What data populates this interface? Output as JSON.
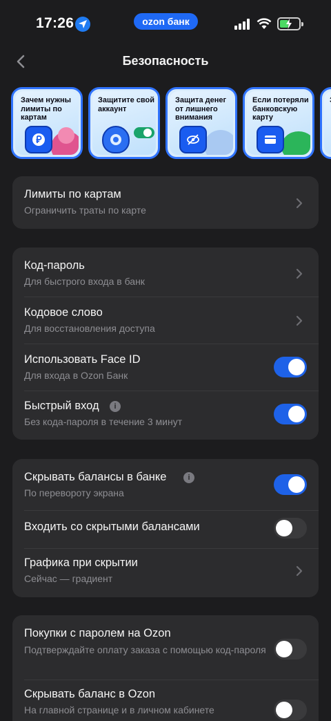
{
  "status_bar": {
    "time": "17:26",
    "brand": "ozon банк",
    "icons": [
      "location-arrow-icon",
      "signal-icon",
      "wifi-icon",
      "battery-charging-icon"
    ]
  },
  "header": {
    "title": "Безопасность",
    "back_icon": "chevron-left-icon"
  },
  "stories": [
    {
      "text": "Зачем нужны лимиты по картам",
      "icon": "ruble-icon"
    },
    {
      "text": "Защитите свой аккаунт",
      "icon": "shield-icon"
    },
    {
      "text": "Защита денег от лишнего внимания",
      "icon": "eye-off-icon"
    },
    {
      "text": "Если потеряли банковскую карту",
      "icon": "card-icon"
    },
    {
      "text": "З о",
      "icon": ""
    }
  ],
  "sections": {
    "limits": {
      "title": "Лимиты по картам",
      "subtitle": "Ограничить траты по карте"
    },
    "auth": {
      "passcode_title": "Код-пароль",
      "passcode_subtitle": "Для быстрого входа в банк",
      "codeword_title": "Кодовое слово",
      "codeword_subtitle": "Для восстановления доступа",
      "faceid_title": "Использовать Face ID",
      "faceid_subtitle": "Для входа в Ozon Банк",
      "faceid_on": true,
      "quick_title": "Быстрый вход",
      "quick_subtitle": "Без кода-пароля в течение 3 минут",
      "quick_on": true
    },
    "balances": {
      "hide_title": "Скрывать балансы в банке",
      "hide_subtitle": "По перевороту экрана",
      "hide_on": true,
      "enter_hidden_title": "Входить со скрытыми балансами",
      "enter_hidden_on": false,
      "graphics_title": "Графика при скрытии",
      "graphics_subtitle": "Сейчас — градиент"
    },
    "ozon": {
      "purchases_title": "Покупки с паролем на Ozon",
      "purchases_subtitle": "Подтверждайте оплату заказа с помощью код-пароля",
      "purchases_on": false,
      "hide_balance_title": "Скрывать баланс в Ozon",
      "hide_balance_subtitle": "На главной странице и в личном кабинете",
      "hide_balance_on": false
    }
  },
  "colors": {
    "background": "#1c1c1e",
    "card": "#2c2c2e",
    "accent": "#1e62e8",
    "secondary_text": "#8e8e93"
  }
}
